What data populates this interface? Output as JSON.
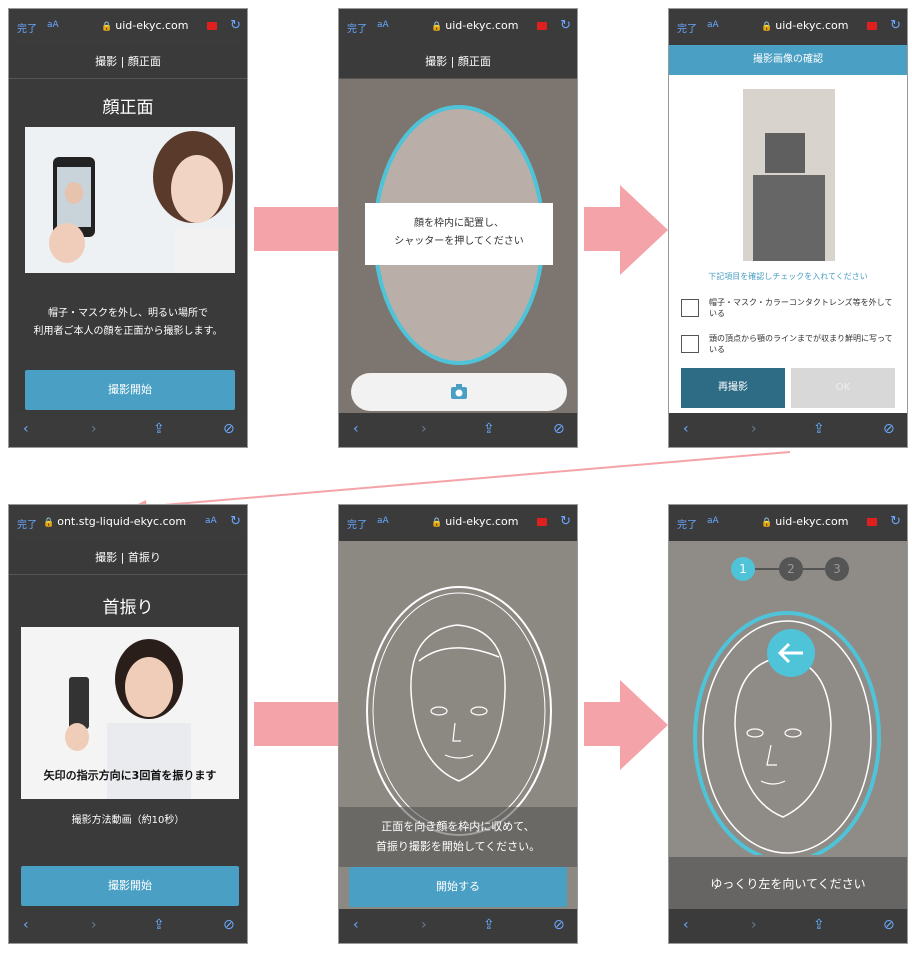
{
  "screens": [
    {
      "status": {
        "done": "完了",
        "aa": "aA",
        "url": "uid-ekyc.com"
      },
      "header": "撮影 | 顔正面",
      "title": "顔正面",
      "description": [
        "帽子・マスクを外し、明るい場所で",
        "利用者ご本人の顔を正面から撮影します。"
      ],
      "button": "撮影開始"
    },
    {
      "status": {
        "done": "完了",
        "aa": "aA",
        "url": "uid-ekyc.com"
      },
      "header": "撮影 | 顔正面",
      "instruction": [
        "顔を枠内に配置し、",
        "シャッターを押してください"
      ]
    },
    {
      "status": {
        "done": "完了",
        "aa": "aA",
        "url": "uid-ekyc.com"
      },
      "header": "撮影画像の確認",
      "note": "下記項目を確認しチェックを入れてください",
      "checks": [
        "帽子・マスク・カラーコンタクトレンズ等を外している",
        "頭の頂点から顎のラインまでが収まり鮮明に写っている"
      ],
      "retake": "再撮影",
      "ok": "OK"
    },
    {
      "status": {
        "done": "完了",
        "aa": "aA",
        "url": "ont.stg-liquid-ekyc.com"
      },
      "header": "撮影 | 首振り",
      "title": "首振り",
      "caption": "矢印の指示方向に3回首を振ります",
      "subtext": "撮影方法動画（約10秒）",
      "button": "撮影開始"
    },
    {
      "status": {
        "done": "完了",
        "aa": "aA",
        "url": "uid-ekyc.com"
      },
      "instruction": [
        "正面を向き顔を枠内に収めて、",
        "首振り撮影を開始してください。"
      ],
      "button": "開始する"
    },
    {
      "status": {
        "done": "完了",
        "aa": "aA",
        "url": "uid-ekyc.com"
      },
      "steps": [
        "1",
        "2",
        "3"
      ],
      "instruction": "ゆっくり左を向いてください"
    }
  ],
  "colors": {
    "accent": "#4a9fc4",
    "arrow": "#f4a3a8",
    "bar": "#3b3b3b",
    "oval": "#4fc3d8"
  },
  "icons": {
    "shutter": "camera-icon",
    "left": "arrow-left-icon"
  }
}
